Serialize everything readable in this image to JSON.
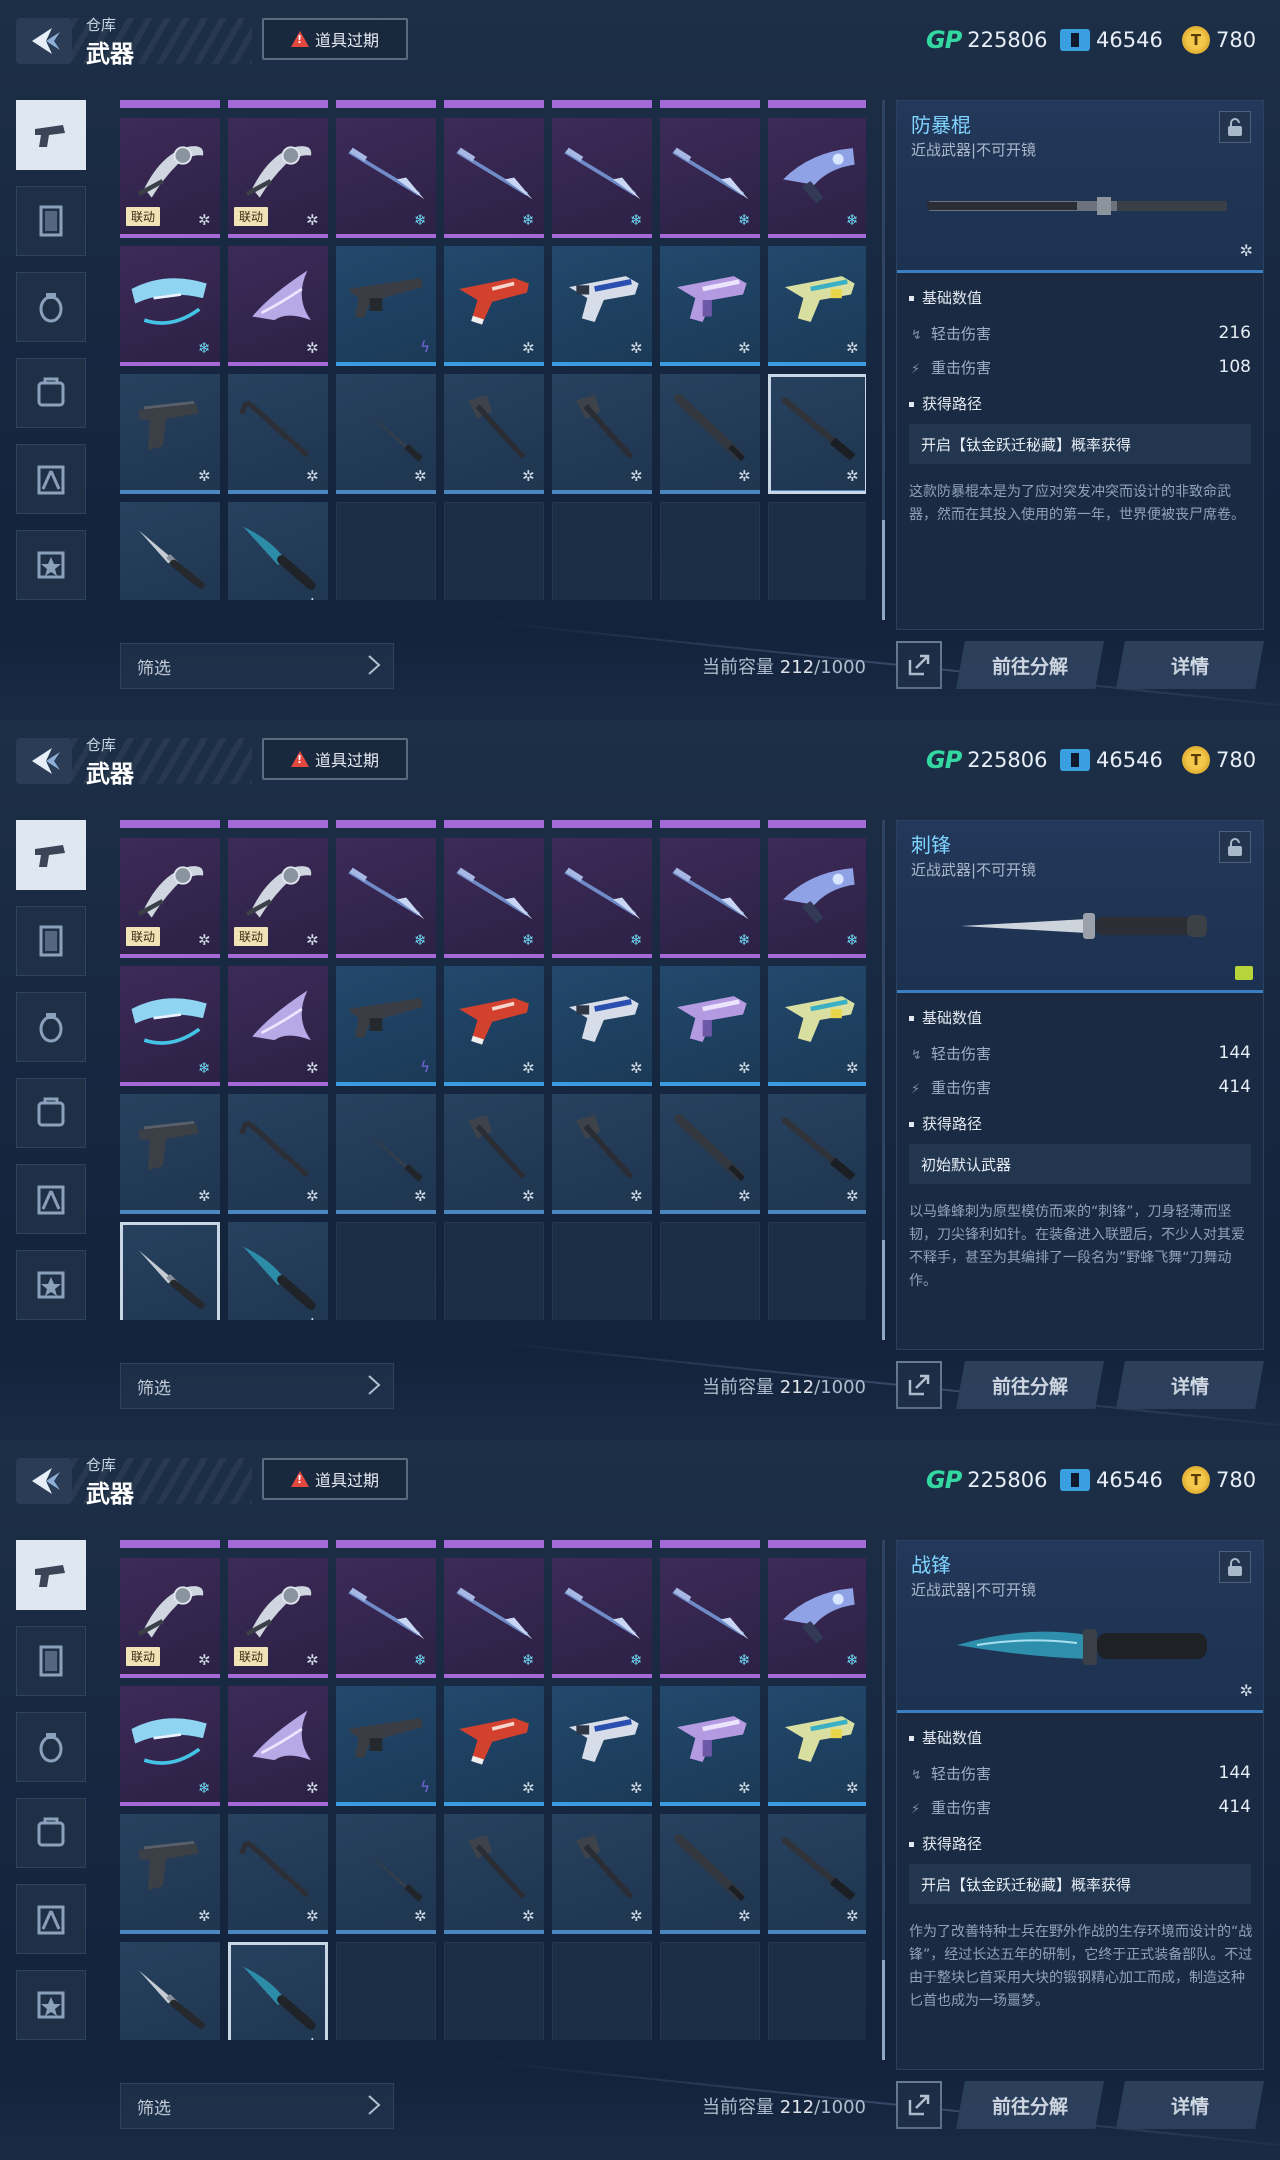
{
  "screens": [
    {
      "header": {
        "crumb": "仓库",
        "title": "武器",
        "expire_label": "道具过期"
      },
      "currency": {
        "gp_label": "GP",
        "gp": "225806",
        "tickets": "46546",
        "coins": "780"
      },
      "filter_label": "筛选",
      "capacity": {
        "label": "当前容量",
        "used": "212",
        "total": "/1000"
      },
      "buttons": {
        "decompose": "前往分解",
        "details": "详情"
      },
      "selected_slot": 20,
      "detail": {
        "name": "防暴棍",
        "type": "近战武器|不可开镜",
        "weapon_icon": "baton-icon",
        "stats_title": "基础数值",
        "light_label": "轻击伤害",
        "light_value": "216",
        "heavy_label": "重击伤害",
        "heavy_value": "108",
        "source_title": "获得路径",
        "source": "开启【钛金跃迁秘藏】概率获得",
        "description": "这款防暴棍本是为了应对突发冲突而设计的非致命武器，然而在其投入使用的第一年，世界便被丧尸席卷。"
      }
    },
    {
      "header": {
        "crumb": "仓库",
        "title": "武器",
        "expire_label": "道具过期"
      },
      "currency": {
        "gp_label": "GP",
        "gp": "225806",
        "tickets": "46546",
        "coins": "780"
      },
      "filter_label": "筛选",
      "capacity": {
        "label": "当前容量",
        "used": "212",
        "total": "/1000"
      },
      "buttons": {
        "decompose": "前往分解",
        "details": "详情"
      },
      "selected_slot": 21,
      "detail": {
        "name": "刺锋",
        "type": "近战武器|不可开镜",
        "weapon_icon": "stiletto-icon",
        "stats_title": "基础数值",
        "light_label": "轻击伤害",
        "light_value": "144",
        "heavy_label": "重击伤害",
        "heavy_value": "414",
        "source_title": "获得路径",
        "source": "初始默认武器",
        "description": "以马蜂蜂刺为原型模仿而来的“刺锋”，刀身轻薄而坚韧，刀尖锋利如针。在装备进入联盟后，不少人对其爱不释手，甚至为其编排了一段名为”野蜂飞舞“刀舞动作。"
      }
    },
    {
      "header": {
        "crumb": "仓库",
        "title": "武器",
        "expire_label": "道具过期"
      },
      "currency": {
        "gp_label": "GP",
        "gp": "225806",
        "tickets": "46546",
        "coins": "780"
      },
      "filter_label": "筛选",
      "capacity": {
        "label": "当前容量",
        "used": "212",
        "total": "/1000"
      },
      "buttons": {
        "decompose": "前往分解",
        "details": "详情"
      },
      "selected_slot": 22,
      "detail": {
        "name": "战锋",
        "type": "近战武器|不可开镜",
        "weapon_icon": "combat-knife-icon",
        "stats_title": "基础数值",
        "light_label": "轻击伤害",
        "light_value": "144",
        "heavy_label": "重击伤害",
        "heavy_value": "414",
        "source_title": "获得路径",
        "source": "开启【钛金跃迁秘藏】概率获得",
        "description": "作为了改善特种士兵在野外作战的生存环境而设计的“战锋”，经过长达五年的研制，它终于正式装备部队。不过由于整块匕首采用大块的锻钢精心加工而成，制造这种匕首也成为一场噩梦。"
      }
    }
  ],
  "inventory": [
    {
      "rarity": "purple",
      "icon": "scythe-icon",
      "tag": "联动",
      "mark": "star"
    },
    {
      "rarity": "purple",
      "icon": "scythe-icon",
      "tag": "联动",
      "mark": "star"
    },
    {
      "rarity": "purple",
      "icon": "spear-icon",
      "tag": "",
      "mark": "cyan"
    },
    {
      "rarity": "purple",
      "icon": "spear-icon",
      "tag": "",
      "mark": "cyan"
    },
    {
      "rarity": "purple",
      "icon": "spear-icon",
      "tag": "",
      "mark": "cyan"
    },
    {
      "rarity": "purple",
      "icon": "spear-icon",
      "tag": "",
      "mark": "cyan"
    },
    {
      "rarity": "purple",
      "icon": "blaster-icon",
      "tag": "",
      "mark": "cyan"
    },
    {
      "rarity": "purple",
      "icon": "crossbow-icon",
      "tag": "",
      "mark": "cyan"
    },
    {
      "rarity": "purple",
      "icon": "wing-blade-icon",
      "tag": "",
      "mark": "star"
    },
    {
      "rarity": "blue",
      "icon": "shotgun-icon",
      "tag": "",
      "mark": "bolt"
    },
    {
      "rarity": "blue",
      "icon": "red-smg-icon",
      "tag": "",
      "mark": "star"
    },
    {
      "rarity": "blue",
      "icon": "blue-smg-icon",
      "tag": "",
      "mark": "star"
    },
    {
      "rarity": "blue",
      "icon": "purple-smg-icon",
      "tag": "",
      "mark": "star"
    },
    {
      "rarity": "blue",
      "icon": "yellow-smg-icon",
      "tag": "",
      "mark": "star"
    },
    {
      "rarity": "plain",
      "icon": "pistol-icon",
      "tag": "",
      "mark": "star"
    },
    {
      "rarity": "plain",
      "icon": "crowbar-icon",
      "tag": "",
      "mark": "star"
    },
    {
      "rarity": "plain",
      "icon": "machete-icon",
      "tag": "",
      "mark": "star"
    },
    {
      "rarity": "plain",
      "icon": "axe-icon",
      "tag": "",
      "mark": "star"
    },
    {
      "rarity": "plain",
      "icon": "axe-icon",
      "tag": "",
      "mark": "star"
    },
    {
      "rarity": "plain",
      "icon": "bat-icon",
      "tag": "",
      "mark": "star"
    },
    {
      "rarity": "plain",
      "icon": "baton-icon",
      "tag": "",
      "mark": "star"
    },
    {
      "rarity": "plain",
      "icon": "stiletto-icon",
      "tag": "",
      "mark": "ybadge"
    },
    {
      "rarity": "plain",
      "icon": "combat-knife-icon",
      "tag": "",
      "mark": "star"
    }
  ],
  "sidebar_tabs": [
    "pistol-icon",
    "card-icon",
    "grenade-icon",
    "backpack-icon",
    "character-icon",
    "badge-icon"
  ],
  "colors": {
    "purple": "#a56ad6",
    "blue": "#3b9be0",
    "accent": "#7fd4ff",
    "gp": "#33d9a0",
    "coin": "#f4c94a",
    "warn": "#e5483f"
  }
}
